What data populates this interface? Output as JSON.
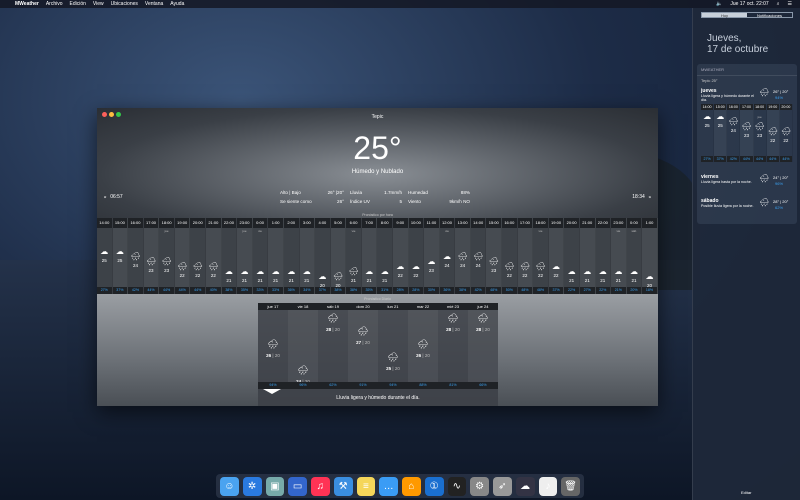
{
  "menubar": {
    "app": "MWeather",
    "items": [
      "Archivo",
      "Edición",
      "View",
      "Ubicaciones",
      "Ventana",
      "Ayuda"
    ],
    "clock": "Jue 17 oct. 22:07"
  },
  "window": {
    "title": "Tepic",
    "temperature": "25°",
    "condition": "Húmedo y Nublado",
    "sunrise": "06:57",
    "sunset": "18:34",
    "stats": [
      [
        "Alto | Bajo",
        "26° |20°",
        "Lluvia",
        "1.7mm/h",
        "Humedad",
        "88%"
      ],
      [
        "Se siente como",
        "26°",
        "Índice UV",
        "5",
        "Viento",
        "9km/h NO"
      ]
    ],
    "hourly_label": "Pronóstico por hora",
    "daily_label": "Pronóstico Diario"
  },
  "hourly": [
    {
      "t": "14:00",
      "v": 25,
      "p": "27%"
    },
    {
      "t": "15:00",
      "v": 25,
      "p": "37%"
    },
    {
      "t": "16:00",
      "v": 24,
      "p": "42%",
      "r": 1
    },
    {
      "t": "17:00",
      "v": 23,
      "p": "44%",
      "r": 1
    },
    {
      "t": "18:00",
      "v": 23,
      "p": "44%",
      "r": 1,
      "d": "jue"
    },
    {
      "t": "19:00",
      "v": 22,
      "p": "44%",
      "r": 1
    },
    {
      "t": "20:00",
      "v": 22,
      "p": "44%",
      "r": 1
    },
    {
      "t": "21:00",
      "v": 22,
      "p": "40%",
      "r": 1
    },
    {
      "t": "22:00",
      "v": 21,
      "p": "38%"
    },
    {
      "t": "23:00",
      "v": 21,
      "p": "35%",
      "d": "jue"
    },
    {
      "t": "0:00",
      "v": 21,
      "p": "33%",
      "d": "vie"
    },
    {
      "t": "1:00",
      "v": 21,
      "p": "33%"
    },
    {
      "t": "2:00",
      "v": 21,
      "p": "36%"
    },
    {
      "t": "3:00",
      "v": 21,
      "p": "34%"
    },
    {
      "t": "4:00",
      "v": 20,
      "p": "37%"
    },
    {
      "t": "5:00",
      "v": 20,
      "p": "38%",
      "r": 1
    },
    {
      "t": "6:00",
      "v": 21,
      "p": "38%",
      "r": 1,
      "d": "vie"
    },
    {
      "t": "7:00",
      "v": 21,
      "p": "35%"
    },
    {
      "t": "8:00",
      "v": 21,
      "p": "31%"
    },
    {
      "t": "9:00",
      "v": 22,
      "p": "28%"
    },
    {
      "t": "10:00",
      "v": 22,
      "p": "28%"
    },
    {
      "t": "11:00",
      "v": 23,
      "p": "30%"
    },
    {
      "t": "12:00",
      "v": 24,
      "p": "36%",
      "d": "vie"
    },
    {
      "t": "13:00",
      "v": 24,
      "p": "38%",
      "r": 1
    },
    {
      "t": "14:00",
      "v": 24,
      "p": "42%",
      "r": 1
    },
    {
      "t": "15:00",
      "v": 23,
      "p": "48%",
      "r": 1
    },
    {
      "t": "16:00",
      "v": 22,
      "p": "50%",
      "r": 1
    },
    {
      "t": "17:00",
      "v": 22,
      "p": "48%",
      "r": 1
    },
    {
      "t": "18:00",
      "v": 22,
      "p": "48%",
      "r": 1,
      "d": "vie"
    },
    {
      "t": "19:00",
      "v": 22,
      "p": "37%"
    },
    {
      "t": "20:00",
      "v": 21,
      "p": "22%"
    },
    {
      "t": "21:00",
      "v": 21,
      "p": "27%"
    },
    {
      "t": "22:00",
      "v": 21,
      "p": "22%"
    },
    {
      "t": "23:00",
      "v": 21,
      "p": "21%",
      "d": "vie"
    },
    {
      "t": "0:00",
      "v": 21,
      "p": "20%",
      "d": "sáb"
    },
    {
      "t": "1:00",
      "v": 20,
      "p": "18%"
    }
  ],
  "daily": [
    {
      "d": "jue 17",
      "hi": 26,
      "lo": "| 20",
      "p": "94%"
    },
    {
      "d": "vie 18",
      "hi": 24,
      "lo": "| 20",
      "p": "96%"
    },
    {
      "d": "sáb 19",
      "hi": 28,
      "lo": "| 20",
      "p": "62%"
    },
    {
      "d": "dom 20",
      "hi": 27,
      "lo": "| 20",
      "p": "91%"
    },
    {
      "d": "lun 21",
      "hi": 25,
      "lo": "| 20",
      "p": "94%"
    },
    {
      "d": "mar 22",
      "hi": 26,
      "lo": "| 20",
      "p": "88%"
    },
    {
      "d": "mié 23",
      "hi": 28,
      "lo": "| 20",
      "p": "81%"
    },
    {
      "d": "jue 24",
      "hi": 28,
      "lo": "| 20",
      "p": "66%"
    }
  ],
  "daily_desc": "Lluvia ligera y húmedo durante el día.",
  "sidebar": {
    "tabs": [
      "Hoy",
      "Notificaciones"
    ],
    "date1": "Jueves,",
    "date2": "17 de octubre",
    "widget_title": "MWEATHER",
    "location": "Tepic 25°",
    "days": [
      {
        "n": "jueves",
        "ds": "Lluvia ligera y húmedo durante el día.",
        "tt": "26° | 20°",
        "pp": "94%"
      },
      {
        "n": "viernes",
        "ds": "Lluvia ligera hasta por la noche.",
        "tt": "24° | 20°",
        "pp": "96%"
      },
      {
        "n": "sábado",
        "ds": "Posible lluvia ligera por la noche.",
        "tt": "28° | 20°",
        "pp": "62%"
      }
    ],
    "edit": "Editar"
  },
  "dock": [
    "finder",
    "safari",
    "preview",
    "screen-sharing",
    "music",
    "xcode",
    "notes",
    "messages",
    "home",
    "1password",
    "activity-monitor",
    "system-preferences",
    "launchpad",
    "mweather",
    "music-file",
    "trash"
  ]
}
